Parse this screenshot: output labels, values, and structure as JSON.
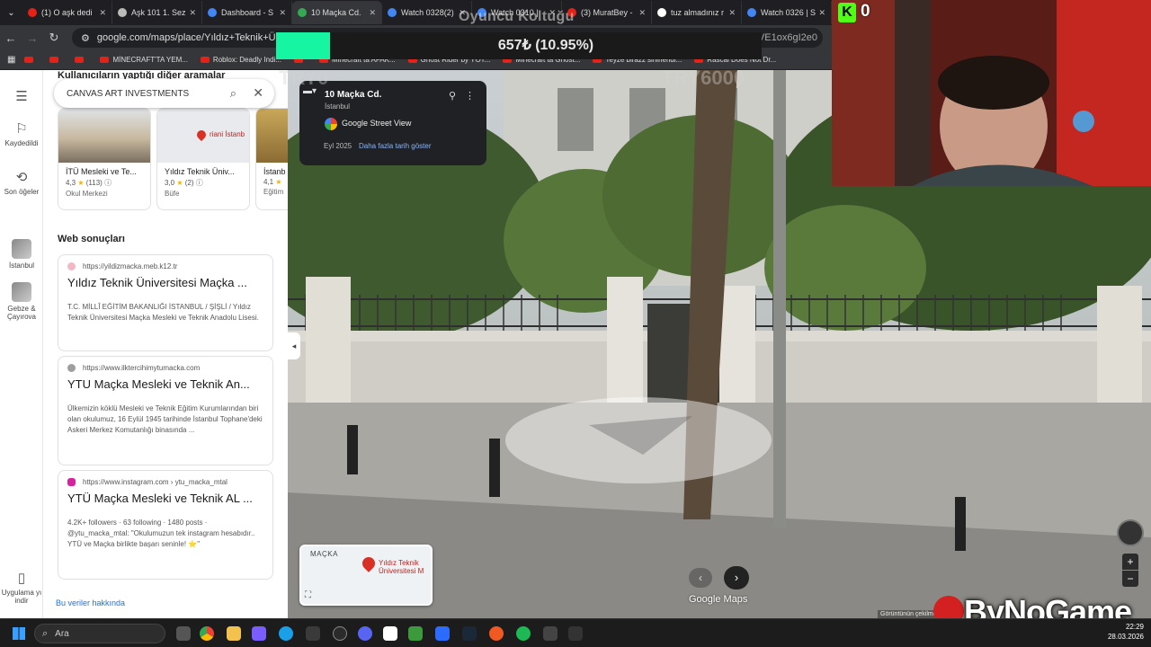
{
  "browser": {
    "tabs": [
      {
        "label": "(1) O aşk dedi",
        "color": "#e62117"
      },
      {
        "label": "Aşk 101 1. Sez",
        "color": "#bbbbbb"
      },
      {
        "label": "Dashboard - S",
        "color": "#4285f4"
      },
      {
        "label": "10 Maçka Cd.",
        "color": "#34a853",
        "active": true
      },
      {
        "label": "Watch 0328(2)",
        "color": "#4285f4"
      },
      {
        "label": "Watch 0310 |",
        "color": "#4285f4"
      },
      {
        "label": "(3) MuratBey -",
        "color": "#e62117"
      },
      {
        "label": "tuz almadınız r",
        "color": "#ffffff"
      },
      {
        "label": "Watch 0326 | S",
        "color": "#4285f4"
      }
    ],
    "url": "google.com/maps/place/Yıldız+Teknik+Üniversit",
    "url_end": "YaxQVE1ox6gI2e0",
    "bookmarks": [
      "",
      "",
      "",
      "MİNECRAFT'TA YEM...",
      "Roblox: Deadly Indi...",
      "",
      "Minecraft ta AFAK...",
      "Ghost Rider by YOT...",
      "Minecraft ta Ghost...",
      "Teyze birazz sinirlendi...",
      "Rascal Does Not Dr..."
    ]
  },
  "overlay": {
    "title": "Oyuncu Koltuğu",
    "progress_text": "657₺ (10.95%)",
    "progress_percent": 10.95,
    "try_left": "TRY0",
    "try_right": "TRY6000",
    "kick_count": "0",
    "kick_icon": "kick-logo-icon",
    "accent": "#15f5a2"
  },
  "left_nav": {
    "saved": "Kaydedildi",
    "recent": "Son öğeler",
    "istanbul": "İstanbul",
    "gebze": "Gebze & Çayırova",
    "apps": "Uygulama yı indir"
  },
  "panel": {
    "related_title": "Kullanıcıların yaptığı diğer aramalar",
    "search_value": "CANVAS ART INVESTMENTS",
    "cards": [
      {
        "name": "İTÜ Mesleki ve Te...",
        "rating": "4,3",
        "count": "(113)",
        "category": "Okul Merkezi"
      },
      {
        "name": "Yıldız Teknik Üniv...",
        "rating": "3,0",
        "count": "(2)",
        "category": "Büfe",
        "map_label": "riani İstanb"
      },
      {
        "name": "İstanb",
        "rating": "4,1",
        "count": "",
        "category": "Eğitim"
      }
    ],
    "web_title": "Web sonuçları",
    "results": [
      {
        "source": "https://yildizmacka.meb.k12.tr",
        "title": "Yıldız Teknik Üniversitesi Maçka ...",
        "desc": "T.C. MİLLÎ EĞİTİM BAKANLIĞI İSTANBUL / ŞİŞLİ / Yıldız Teknik Üniversitesi Maçka Mesleki ve Teknik Anadolu Lisesi.",
        "color": "#f4b8c4"
      },
      {
        "source": "https://www.ilktercihimytumacka.com",
        "title": "YTU Maçka Mesleki ve Teknik An...",
        "desc": "Ülkemizin köklü Mesleki ve Teknik Eğitim Kurumlarından biri olan okulumuz, 16 Eylül 1945 tarihinde İstanbul Tophane'deki Askeri Merkez Komutanlığı binasında ...",
        "color": "#9e9e9e"
      },
      {
        "source": "https://www.instagram.com › ytu_macka_mtal",
        "title": "YTÜ Maçka Mesleki ve Teknik AL ...",
        "desc": "4.2K+ followers · 63 following · 1480 posts · @ytu_macka_mtal: \"Okulumuzun tek instagram hesabıdır.. YTÜ ve Maçka birlikte başarı seninle! ⭐\"",
        "color": "#d6249f"
      }
    ],
    "about": "Bu veriler hakkında"
  },
  "street_view": {
    "street_name": "10 Maçka Cd.",
    "city": "İstanbul",
    "source": "Google Street View",
    "date": "Eyl 2025",
    "more_dates": "Daha fazla tarih göster",
    "minimap_label": "MAÇKA",
    "minimap_poi": "Yıldız Teknik Üniversitesi M",
    "logo_text": "Google Maps",
    "footer": "Görüntünün çekilme",
    "watermark": "ByNoGame"
  },
  "taskbar": {
    "search_placeholder": "Ara",
    "time": "22:29",
    "date": "28.03.2026"
  }
}
